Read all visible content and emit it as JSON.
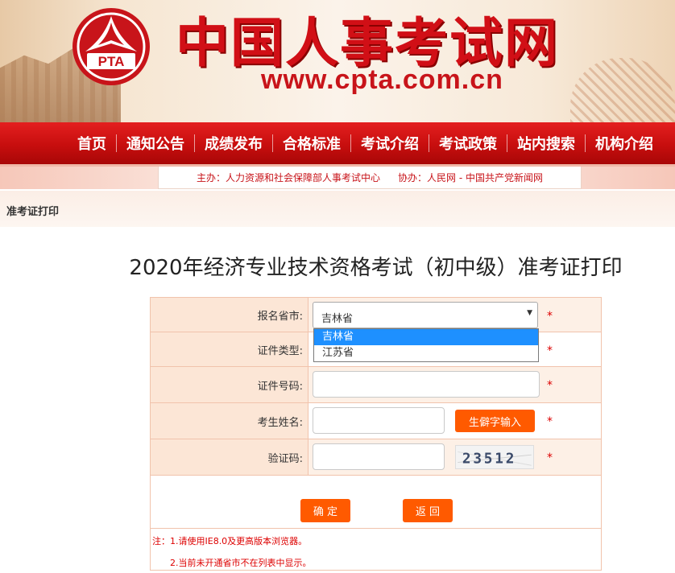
{
  "header": {
    "logo_text": "PTA",
    "site_title": "中国人事考试网",
    "site_url": "www.cpta.com.cn"
  },
  "nav": {
    "items": [
      "首页",
      "通知公告",
      "成绩发布",
      "合格标准",
      "考试介绍",
      "考试政策",
      "站内搜索",
      "机构介绍"
    ]
  },
  "sponsor": {
    "host": "主办：人力资源和社会保障部人事考试中心",
    "co_host": "协办：人民网 - 中国共产党新闻网"
  },
  "breadcrumb": "准考证打印",
  "page_title": "2020年经济专业技术资格考试（初中级）准考证打印",
  "form": {
    "province_label": "报名省市:",
    "province_value": "吉林省",
    "province_options": [
      "吉林省",
      "江苏省"
    ],
    "id_type_label": "证件类型:",
    "id_number_label": "证件号码:",
    "id_number_value": "",
    "name_label": "考生姓名:",
    "name_value": "",
    "rare_char_button": "生僻字输入",
    "captcha_label": "验证码:",
    "captcha_value": "",
    "captcha_text": "23512",
    "required_mark": "*",
    "confirm_button": "确 定",
    "back_button": "返 回"
  },
  "notes": {
    "note1": "注：1.请使用IE8.0及更高版本浏览器。",
    "note2": "2.当前未开通省市不在列表中显示。"
  },
  "colors": {
    "brand_red": "#d10f16",
    "nav_red": "#c70e0e",
    "button_orange": "#ff5a00",
    "label_bg": "#fce6d6",
    "option_highlight": "#1e90ff"
  }
}
